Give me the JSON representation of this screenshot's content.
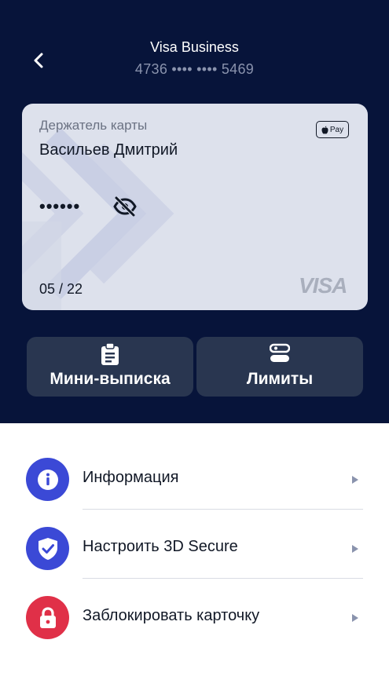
{
  "header": {
    "title": "Visa Business",
    "card_number": "4736 •••• •••• 5469"
  },
  "card": {
    "holder_label": "Держатель карты",
    "holder_name": "Васильев Дмитрий",
    "masked_code": "••••••",
    "expiry": "05 / 22",
    "apple_pay_label": "Pay",
    "network_logo": "VISA",
    "colors": {
      "card_bg": "#dde1ec",
      "pattern": "#c6cce3"
    }
  },
  "actions": [
    {
      "label": "Мини-выписка",
      "icon": "clipboard-icon"
    },
    {
      "label": "Лимиты",
      "icon": "toggle-limits-icon"
    }
  ],
  "menu": [
    {
      "label": "Информация",
      "icon": "info-icon",
      "color": "#3b49d6"
    },
    {
      "label": "Настроить 3D Secure",
      "icon": "shield-check-icon",
      "color": "#3b49d6"
    },
    {
      "label": "Заблокировать карточку",
      "icon": "lock-icon",
      "color": "#e03048"
    }
  ],
  "colors": {
    "header_bg": "#07143a",
    "action_button_bg": "#293650",
    "accent_blue": "#3b49d6",
    "danger_red": "#e03048"
  }
}
